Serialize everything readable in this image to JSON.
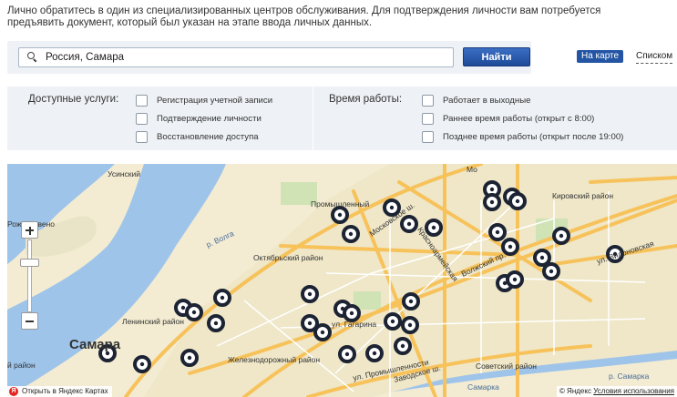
{
  "intro": {
    "line1": "Лично обратитесь в один из специализированных центров обслуживания. Для подтверждения личности вам потребуется",
    "line2": "предъявить документ, который был указан на этапе ввода личных данных."
  },
  "search": {
    "value": "Россия, Самара",
    "placeholder": "",
    "button_label": "Найти"
  },
  "view_toggle": {
    "map_label": "На карте",
    "list_label": "Списком"
  },
  "filters": {
    "services_title": "Доступные услуги:",
    "services": [
      "Регистрация учетной записи",
      "Подтверждение личности",
      "Восстановление доступа"
    ],
    "hours_title": "Время работы:",
    "hours": [
      "Работает в выходные",
      "Раннее время работы (открыт с 8:00)",
      "Позднее время работы (открыт после 19:00)"
    ]
  },
  "map": {
    "labels": {
      "usinsky": "Усинский",
      "rozhdestveno": "Рождествено",
      "r_volga": "р. Волга",
      "promyshlenny": "Промышленный",
      "moskovskoe": "Московское ш.",
      "krasnoarmeiskaya": "Красноармейская",
      "mo": "Мо",
      "kirovsky": "Кировский район",
      "vilonovskaya": "ул. Вилоновская",
      "oktyabrsky": "Октябрьский район",
      "volzhsky": "Волжский пр.",
      "leninsky": "Ленинский район",
      "samara": "Самара",
      "gagarina": "ул. Гагарина",
      "zheleznodorozhny": "Железнодорожный район",
      "promyshlennosti": "ул. Промышленности",
      "zavodskoe": "Заводское ш.",
      "sovetsky": "Советский район",
      "samarka": "р. Самарка",
      "samarka2": "Самарка",
      "raion_left": "й район"
    },
    "open_yandex_label": "Открыть в Яндекс Картах",
    "yandex_logo_letter": "Я",
    "copyright": "© Яндекс",
    "terms_label": "Условия использования",
    "colors": {
      "water": "#9fc4ea",
      "land": "#f3ecd2",
      "road": "#f7c25a",
      "marker": "#1c2333"
    }
  }
}
